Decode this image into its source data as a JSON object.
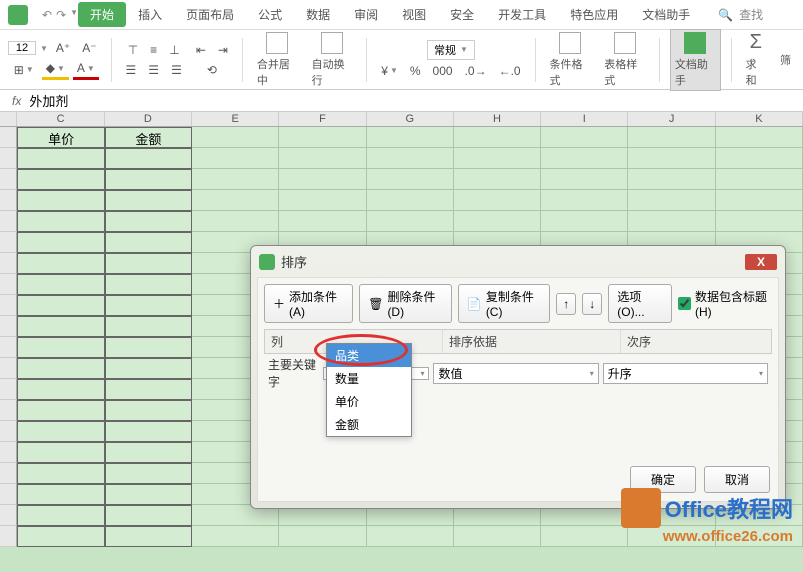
{
  "tabs": {
    "items": [
      "开始",
      "插入",
      "页面布局",
      "公式",
      "数据",
      "审阅",
      "视图",
      "安全",
      "开发工具",
      "特色应用",
      "文档助手"
    ],
    "active_index": 0,
    "search": "查找"
  },
  "ribbon": {
    "font_size": "12",
    "number_format": "常规",
    "merge": "合并居中",
    "wrap": "自动换行",
    "cond_fmt": "条件格式",
    "table_style": "表格样式",
    "doc_helper": "文档助手",
    "sum": "求和",
    "filter": "筛"
  },
  "formula": {
    "fx": "fx",
    "value": "外加剂"
  },
  "columns": [
    "",
    "C",
    "D",
    "E",
    "F",
    "G",
    "H",
    "I",
    "J",
    "K"
  ],
  "headers": {
    "c": "单价",
    "d": "金额"
  },
  "dialog": {
    "title": "排序",
    "add": "添加条件(A)",
    "del": "删除条件(D)",
    "copy": "复制条件(C)",
    "options": "选项(O)...",
    "has_header": "数据包含标题(H)",
    "col": "列",
    "basis": "排序依据",
    "order": "次序",
    "main_key": "主要关键字",
    "basis_val": "数值",
    "order_val": "升序",
    "ok": "确定",
    "cancel": "取消"
  },
  "dropdown": {
    "items": [
      "品类",
      "数量",
      "单价",
      "金额"
    ],
    "highlight": 0
  },
  "watermark": {
    "title_cn": "Office教程网",
    "url": "www.office26.com"
  }
}
